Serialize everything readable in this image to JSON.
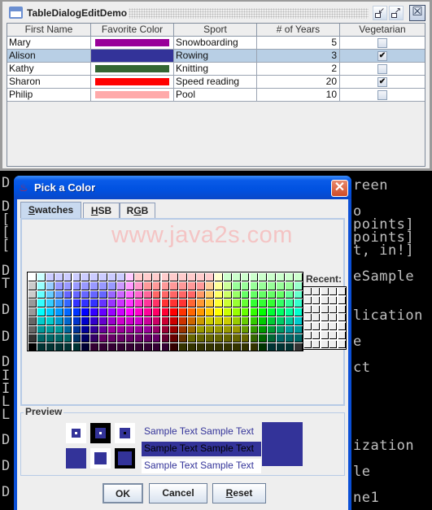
{
  "main_window": {
    "title": "TableDialogEditDemo",
    "buttons": {
      "iconify": "↙",
      "maximize": "↗",
      "close": "☒"
    }
  },
  "table": {
    "columns": [
      "First Name",
      "Favorite Color",
      "Sport",
      "# of Years",
      "Vegetarian"
    ],
    "selected_row": 1,
    "rows": [
      {
        "first_name": "Mary",
        "color": "#990099",
        "sport": "Snowboarding",
        "years": "5",
        "vegetarian": false
      },
      {
        "first_name": "Alison",
        "color": "#333399",
        "sport": "Rowing",
        "years": "3",
        "vegetarian": true
      },
      {
        "first_name": "Kathy",
        "color": "#336633",
        "sport": "Knitting",
        "years": "2",
        "vegetarian": false
      },
      {
        "first_name": "Sharon",
        "color": "#ff0000",
        "sport": "Speed reading",
        "years": "20",
        "vegetarian": true
      },
      {
        "first_name": "Philip",
        "color": "#ffaaaa",
        "sport": "Pool",
        "years": "10",
        "vegetarian": false
      }
    ],
    "check_glyph": "✔"
  },
  "console": {
    "left_lines": [
      "D",
      "D",
      "[",
      "[",
      "[",
      "D",
      "T",
      "D",
      "D",
      "D",
      "I",
      "I",
      "L",
      "L",
      "D",
      "D",
      "D"
    ],
    "right_lines": [
      "reen",
      "o",
      "points]",
      "points]",
      "t, in!]",
      "eSample",
      "lication",
      "e",
      "ct",
      "ization",
      "le",
      "ne1"
    ]
  },
  "dialog": {
    "title": "Pick a Color",
    "close_glyph": "✕",
    "java_icon_glyph": "♨",
    "tabs": [
      {
        "label_pre": "",
        "mnemonic": "S",
        "label_post": "watches",
        "active": true
      },
      {
        "label_pre": "",
        "mnemonic": "H",
        "label_post": "SB",
        "active": false
      },
      {
        "label_pre": "R",
        "mnemonic": "G",
        "label_post": "B",
        "active": false
      }
    ],
    "watermark": "www.java2s.com",
    "recent_label": "Recent:",
    "preview_label": "Preview",
    "sample_text": "Sample Text  Sample Text",
    "current_color": "#333399",
    "buttons": {
      "ok": "OK",
      "cancel": "Cancel",
      "reset_mnemonic": "R",
      "reset_rest": "eset"
    },
    "swatch_colors": [
      [
        "#ffffff",
        "#ccffff",
        "#ccccff",
        "#ccccff",
        "#ccccff",
        "#ccccff",
        "#ccccff",
        "#ccccff",
        "#ccccff",
        "#ccccff",
        "#ccccff",
        "#ffccff",
        "#ffcccc",
        "#ffcccc",
        "#ffcccc",
        "#ffcccc",
        "#ffcccc",
        "#ffcccc",
        "#ffcccc",
        "#ffcccc",
        "#ffcccc",
        "#ffffcc",
        "#ccffcc",
        "#ccffcc",
        "#ccffcc",
        "#ccffcc",
        "#ccffcc",
        "#ccffcc",
        "#ccffcc",
        "#ccffcc",
        "#ccffcc"
      ],
      [
        "#cccccc",
        "#99ffff",
        "#99ccff",
        "#9999ff",
        "#9999ff",
        "#9999ff",
        "#9999ff",
        "#9999ff",
        "#9999ff",
        "#9999ff",
        "#cc99ff",
        "#ff99ff",
        "#ff99cc",
        "#ff9999",
        "#ff9999",
        "#ff9999",
        "#ff9999",
        "#ff9999",
        "#ff9999",
        "#ff9999",
        "#ffcc99",
        "#ffff99",
        "#ccff99",
        "#99ff99",
        "#99ff99",
        "#99ff99",
        "#99ff99",
        "#99ff99",
        "#99ff99",
        "#99ff99",
        "#99ffcc"
      ],
      [
        "#cccccc",
        "#66ffff",
        "#66ccff",
        "#6699ff",
        "#6666ff",
        "#6666ff",
        "#6666ff",
        "#6666ff",
        "#6666ff",
        "#9966ff",
        "#cc66ff",
        "#ff66ff",
        "#ff66cc",
        "#ff6699",
        "#ff6666",
        "#ff6666",
        "#ff6666",
        "#ff6666",
        "#ff6666",
        "#ff9966",
        "#ffcc66",
        "#ffff66",
        "#ccff66",
        "#99ff66",
        "#66ff66",
        "#66ff66",
        "#66ff66",
        "#66ff66",
        "#66ff66",
        "#66ff99",
        "#66ffcc"
      ],
      [
        "#999999",
        "#33ffff",
        "#33ccff",
        "#3399ff",
        "#3366ff",
        "#3333ff",
        "#3333ff",
        "#3333ff",
        "#6633ff",
        "#9933ff",
        "#cc33ff",
        "#ff33ff",
        "#ff33cc",
        "#ff3399",
        "#ff3366",
        "#ff3333",
        "#ff3333",
        "#ff3333",
        "#ff6633",
        "#ff9933",
        "#ffcc33",
        "#ffff33",
        "#ccff33",
        "#99ff33",
        "#66ff33",
        "#33ff33",
        "#33ff33",
        "#33ff33",
        "#33ff66",
        "#33ff99",
        "#33ffcc"
      ],
      [
        "#999999",
        "#00ffff",
        "#00ccff",
        "#0099ff",
        "#0066ff",
        "#0033ff",
        "#0000ff",
        "#3300ff",
        "#6600ff",
        "#9900ff",
        "#cc00ff",
        "#ff00ff",
        "#ff00cc",
        "#ff0099",
        "#ff0066",
        "#ff0033",
        "#ff0000",
        "#ff3300",
        "#ff6600",
        "#ff9900",
        "#ffcc00",
        "#ffff00",
        "#ccff00",
        "#99ff00",
        "#66ff00",
        "#33ff00",
        "#00ff00",
        "#00ff33",
        "#00ff66",
        "#00ff99",
        "#00ffcc"
      ],
      [
        "#666666",
        "#00cccc",
        "#00cccc",
        "#0099cc",
        "#0066cc",
        "#0033cc",
        "#0000cc",
        "#3300cc",
        "#6600cc",
        "#9900cc",
        "#cc00cc",
        "#cc00cc",
        "#cc00cc",
        "#cc0099",
        "#cc0066",
        "#cc0033",
        "#cc0000",
        "#cc3300",
        "#cc6600",
        "#cc9900",
        "#cccc00",
        "#cccc00",
        "#cccc00",
        "#99cc00",
        "#66cc00",
        "#33cc00",
        "#00cc00",
        "#00cc33",
        "#00cc66",
        "#00cc99",
        "#00cccc"
      ],
      [
        "#666666",
        "#009999",
        "#009999",
        "#009999",
        "#006699",
        "#003399",
        "#000099",
        "#330099",
        "#660099",
        "#990099",
        "#990099",
        "#990099",
        "#990099",
        "#990099",
        "#990066",
        "#990033",
        "#990000",
        "#993300",
        "#996600",
        "#999900",
        "#999900",
        "#999900",
        "#999900",
        "#999900",
        "#669900",
        "#339900",
        "#009900",
        "#009933",
        "#009966",
        "#009999",
        "#009999"
      ],
      [
        "#333333",
        "#006666",
        "#006666",
        "#006666",
        "#006666",
        "#003366",
        "#000066",
        "#330066",
        "#660066",
        "#660066",
        "#660066",
        "#660066",
        "#660066",
        "#660066",
        "#660066",
        "#660033",
        "#660000",
        "#663300",
        "#666600",
        "#666600",
        "#666600",
        "#666600",
        "#666600",
        "#666600",
        "#666600",
        "#336600",
        "#006600",
        "#006633",
        "#006666",
        "#006666",
        "#006666"
      ],
      [
        "#000000",
        "#003333",
        "#003333",
        "#003333",
        "#003333",
        "#003333",
        "#000033",
        "#330033",
        "#330033",
        "#330033",
        "#330033",
        "#330033",
        "#330033",
        "#330033",
        "#330033",
        "#330033",
        "#330000",
        "#333300",
        "#333300",
        "#333300",
        "#333300",
        "#333300",
        "#333300",
        "#333300",
        "#333300",
        "#333300",
        "#003300",
        "#003333",
        "#003333",
        "#003333",
        "#333333"
      ]
    ]
  }
}
